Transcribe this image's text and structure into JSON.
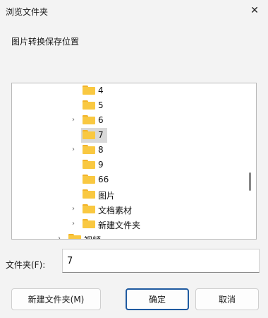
{
  "window": {
    "title": "浏览文件夹",
    "close_glyph": "✕"
  },
  "description": "图片转换保存位置",
  "tree": {
    "items": [
      {
        "label": "4",
        "expandable": false,
        "selected": false
      },
      {
        "label": "5",
        "expandable": false,
        "selected": false
      },
      {
        "label": "6",
        "expandable": true,
        "selected": false
      },
      {
        "label": "7",
        "expandable": false,
        "selected": true
      },
      {
        "label": "8",
        "expandable": true,
        "selected": false
      },
      {
        "label": "9",
        "expandable": false,
        "selected": false
      },
      {
        "label": "66",
        "expandable": false,
        "selected": false
      },
      {
        "label": "图片",
        "expandable": false,
        "selected": false
      },
      {
        "label": "文档素材",
        "expandable": true,
        "selected": false
      },
      {
        "label": "新建文件夹",
        "expandable": true,
        "selected": false
      },
      {
        "label": "视频",
        "expandable": true,
        "selected": false
      }
    ],
    "chevron_glyph": "›"
  },
  "folder_field": {
    "label": "文件夹(F):",
    "value": "7"
  },
  "buttons": {
    "new_folder": "新建文件夹(M)",
    "ok": "确定",
    "cancel": "取消"
  },
  "colors": {
    "folder": "#f9c841",
    "folder_tab": "#f2b32a",
    "selection": "#d9d9d9",
    "default_button_border": "#1f5aa0"
  }
}
